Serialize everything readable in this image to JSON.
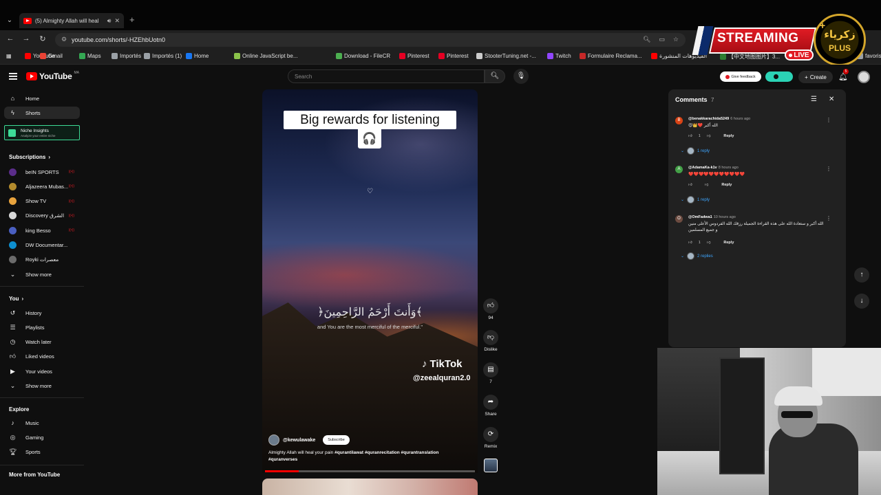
{
  "browser": {
    "tab_title": "(5) Almighty Allah will heal",
    "url": "youtube.com/shorts/-HZEhbUotn0",
    "bookmarks": [
      {
        "label": "YouTube",
        "color": "#ff0000"
      },
      {
        "label": "Gmail",
        "color": "#ea4335"
      },
      {
        "label": "Maps",
        "color": "#34a853"
      },
      {
        "label": "Importés",
        "color": "#9aa0a6"
      },
      {
        "label": "Importés (1)",
        "color": "#9aa0a6"
      },
      {
        "label": "Home",
        "color": "#1877f2"
      },
      {
        "label": "Online JavaScript be...",
        "color": "#8bc34a"
      },
      {
        "label": "Download - FileCR",
        "color": "#4caf50"
      },
      {
        "label": "Pinterest",
        "color": "#e60023"
      },
      {
        "label": "Pinterest",
        "color": "#e60023"
      },
      {
        "label": "StooterTuning.net -...",
        "color": "#cccccc"
      },
      {
        "label": "Twitch",
        "color": "#9146ff"
      },
      {
        "label": "Formulaire Reclama...",
        "color": "#c62828"
      },
      {
        "label": "الفيديوهات المنشورة",
        "color": "#ff0000"
      },
      {
        "label": "【中文地图图片】3...",
        "color": "#2e7d32"
      },
      {
        "label": "favoris",
        "color": "#9aa0a6"
      }
    ]
  },
  "overlay": {
    "streaming_label": "STREAMING",
    "live_label": "LIVE",
    "logo_line1": "زكرياء",
    "logo_line2": "PLUS",
    "logo_plus": "+"
  },
  "youtube": {
    "logo_text": "YouTube",
    "logo_country": "MA",
    "search_placeholder": "Search",
    "feedback_label": "Give feedback",
    "create_label": "Create",
    "notification_count": "5"
  },
  "sidebar": {
    "home": "Home",
    "shorts": "Shorts",
    "niche_title": "Niche Insights",
    "niche_sub": "Analyze your entire niche",
    "subscriptions_label": "Subscriptions",
    "subscriptions": [
      {
        "name": "beIN SPORTS",
        "color": "#5b2d8a",
        "live": true
      },
      {
        "name": "Aljazeera Mubas...",
        "color": "#b38b2d",
        "live": true
      },
      {
        "name": "Show TV",
        "color": "#e8a33d",
        "live": true
      },
      {
        "name": "Discovery الشرق",
        "color": "#d9d9d9",
        "live": true
      },
      {
        "name": "king Besso",
        "color": "#4a5fc1",
        "live": true
      },
      {
        "name": "DW Documentar...",
        "color": "#0d8ecf",
        "live": false
      },
      {
        "name": "Royki معصرات",
        "color": "#6b6b6b",
        "live": false
      }
    ],
    "show_more": "Show more",
    "you_label": "You",
    "you_items": [
      "History",
      "Playlists",
      "Watch later",
      "Liked videos",
      "Your videos",
      "Show more"
    ],
    "explore_label": "Explore",
    "explore_items": [
      "Music",
      "Gaming",
      "Sports"
    ],
    "more_label": "More from YouTube"
  },
  "short": {
    "caption": "Big rewards for listening",
    "emoji": "🎧",
    "arabic_verse": "﴿وَأَنتَ أَرْحَمُ الرَّاحِمِينَ﴾",
    "english_verse": "and You are the most merciful of the merciful.\"",
    "watermark": "TikTok",
    "watermark_handle": "@zeealquran2.0",
    "channel": "@kewulawake",
    "subscribe": "Subscribe",
    "description_text": "Almighty Allah will heal your pain ",
    "hashtags": "#qurantilawat #quranrecitation #qurantranslation #quranverses",
    "progress": 0.16
  },
  "actions": {
    "likes": "94",
    "dislike": "Dislike",
    "comments": "7",
    "share": "Share",
    "remix": "Remix"
  },
  "comments_panel": {
    "title": "Comments",
    "count": "7",
    "items": [
      {
        "author": "@benakkarachida5249",
        "time": "6 hours ago",
        "text": "😍👑❤️ الله أكبر",
        "likes": "1",
        "reply": "Reply",
        "replies": "1 reply",
        "initial": "B",
        "color": "#d84315"
      },
      {
        "author": "@AdamaKa-k1v",
        "time": "8 hours ago",
        "text": "❤️❤️❤️❤️❤️❤️❤️❤️❤️❤️❤️",
        "likes": "",
        "reply": "Reply",
        "replies": "1 reply",
        "initial": "A",
        "color": "#43a047"
      },
      {
        "author": "@OmFadwa1",
        "time": "10 hours ago",
        "text": "الله أكبر و ستعادة الله على هذه القراءة الجميلة رزقك الله الفردوس الأعلى منين و جميع المسلمين",
        "likes": "1",
        "reply": "Reply",
        "replies": "2 replies",
        "initial": "O",
        "color": "#6d4c41"
      }
    ]
  }
}
